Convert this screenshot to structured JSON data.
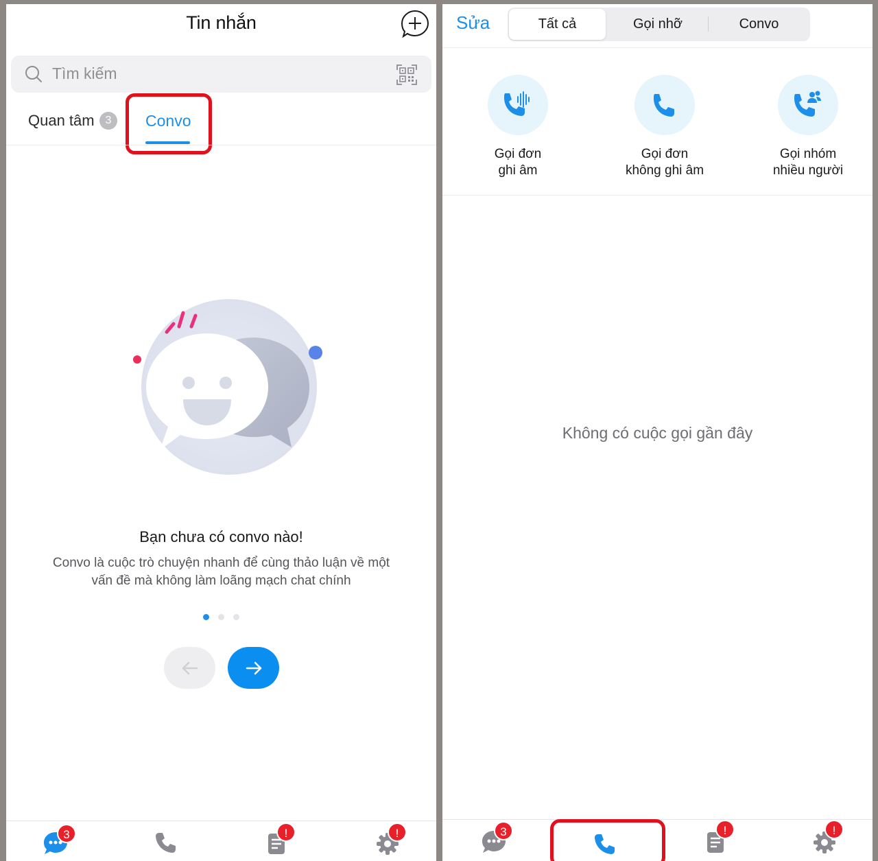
{
  "left_screen": {
    "title": "Tin nhắn",
    "search": {
      "placeholder": "Tìm kiếm"
    },
    "tabs": [
      {
        "label": "Quan tâm",
        "count": "3",
        "active": false
      },
      {
        "label": "Convo",
        "active": true
      }
    ],
    "empty_state": {
      "title": "Bạn chưa có convo nào!",
      "description": "Convo là cuộc trò chuyện nhanh để cùng thảo luận về một vấn đề mà không làm loãng mạch chat chính",
      "page_count": 3,
      "current_page": 1
    },
    "bottom_nav": [
      {
        "icon": "chat-icon",
        "badge": "3",
        "active": true
      },
      {
        "icon": "phone-icon",
        "badge": "",
        "active": false
      },
      {
        "icon": "contacts-icon",
        "badge": "!",
        "active": false
      },
      {
        "icon": "settings-icon",
        "badge": "!",
        "active": false
      }
    ]
  },
  "right_screen": {
    "edit_label": "Sửa",
    "segments": [
      {
        "label": "Tất cả",
        "active": true
      },
      {
        "label": "Gọi nhỡ",
        "active": false
      },
      {
        "label": "Convo",
        "active": false
      }
    ],
    "call_options": [
      {
        "line1": "Gọi đơn",
        "line2": "ghi âm",
        "icon": "phone-recording-icon"
      },
      {
        "line1": "Gọi đơn",
        "line2": "không ghi âm",
        "icon": "phone-icon"
      },
      {
        "line1": "Gọi nhóm",
        "line2": "nhiều người",
        "icon": "group-call-icon"
      }
    ],
    "empty_message": "Không có cuộc gọi gần đây",
    "bottom_nav": [
      {
        "icon": "chat-icon",
        "badge": "3",
        "active": false
      },
      {
        "icon": "phone-icon",
        "badge": "",
        "active": true
      },
      {
        "icon": "contacts-icon",
        "badge": "!",
        "active": false
      },
      {
        "icon": "settings-icon",
        "badge": "!",
        "active": false
      }
    ]
  },
  "colors": {
    "accent": "#1d8fe8",
    "highlight_box": "#e0101c",
    "badge": "#e8202a",
    "inactive_icon": "#8a8a90"
  }
}
